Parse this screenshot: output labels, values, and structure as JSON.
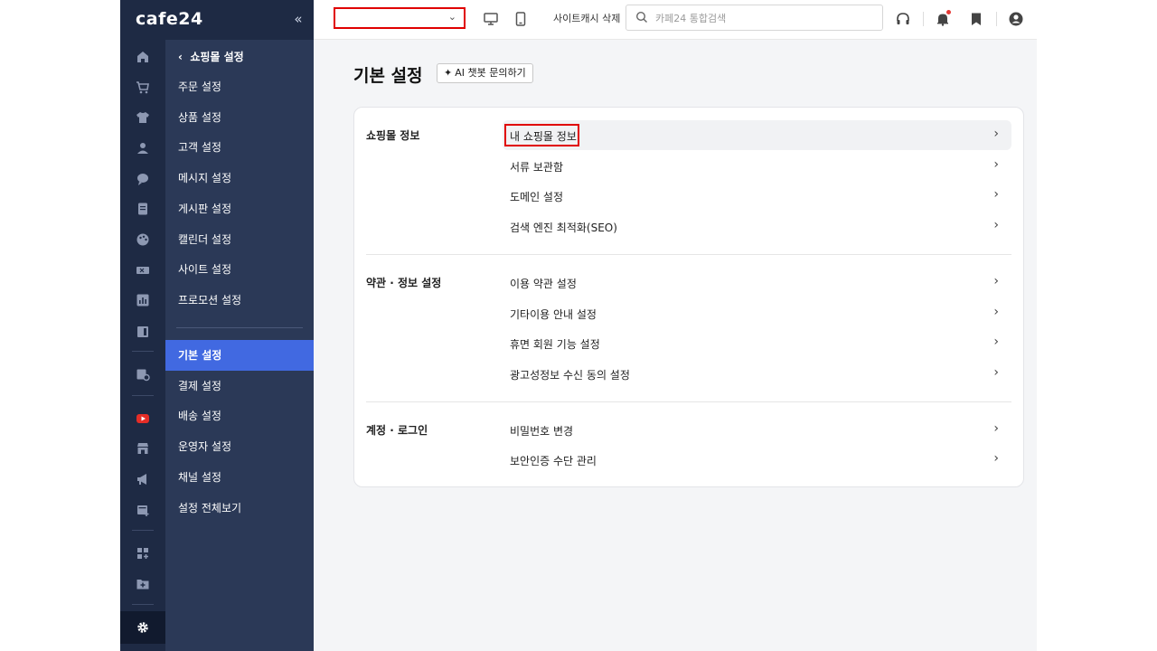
{
  "brand": {
    "logo": "cafe24",
    "collapse": "«"
  },
  "topbar": {
    "mall_select_value": "",
    "cache_clear": "사이트캐시 삭제",
    "search_placeholder": "카페24 통합검색"
  },
  "submenu": {
    "back": "쇼핑몰 설정",
    "items_top": [
      "주문 설정",
      "상품 설정",
      "고객 설정",
      "메시지 설정",
      "게시판 설정",
      "캘린더 설정",
      "사이트 설정",
      "프로모션 설정"
    ],
    "items_bottom": [
      "기본 설정",
      "결제 설정",
      "배송 설정",
      "운영자 설정",
      "채널 설정",
      "설정 전체보기"
    ],
    "active": "기본 설정"
  },
  "page": {
    "title": "기본 설정",
    "ai_button": "AI 챗봇 문의하기"
  },
  "sections": [
    {
      "title": "쇼핑몰 정보",
      "items": [
        "내 쇼핑몰 정보",
        "서류 보관함",
        "도메인 설정",
        "검색 엔진 최적화(SEO)"
      ]
    },
    {
      "title": "약관 · 정보 설정",
      "items": [
        "이용 약관 설정",
        "기타이용 안내 설정",
        "휴면 회원 기능 설정",
        "광고성정보 수신 동의 설정"
      ]
    },
    {
      "title": "계정 · 로그인",
      "items": [
        "비밀번호 변경",
        "보안인증 수단 관리"
      ]
    }
  ],
  "icons": {
    "rail": [
      "home-icon",
      "cart-icon",
      "shirt-icon",
      "user-icon",
      "chat-icon",
      "board-icon",
      "palette-icon",
      "ticket-icon",
      "chart-icon",
      "layout-icon",
      "settings-store-icon",
      "youtube-icon",
      "store-icon",
      "megaphone-icon",
      "shop-add-icon",
      "apps-icon",
      "folder-add-icon",
      "gear-icon"
    ],
    "topbar": [
      "desktop-icon",
      "mobile-icon",
      "search-icon",
      "headset-icon",
      "bell-icon",
      "bookmark-icon",
      "account-icon"
    ]
  },
  "colors": {
    "rail": "#1e2a44",
    "submenu": "#2b3957",
    "active": "#4169e1",
    "highlight_box": "#e00000"
  }
}
